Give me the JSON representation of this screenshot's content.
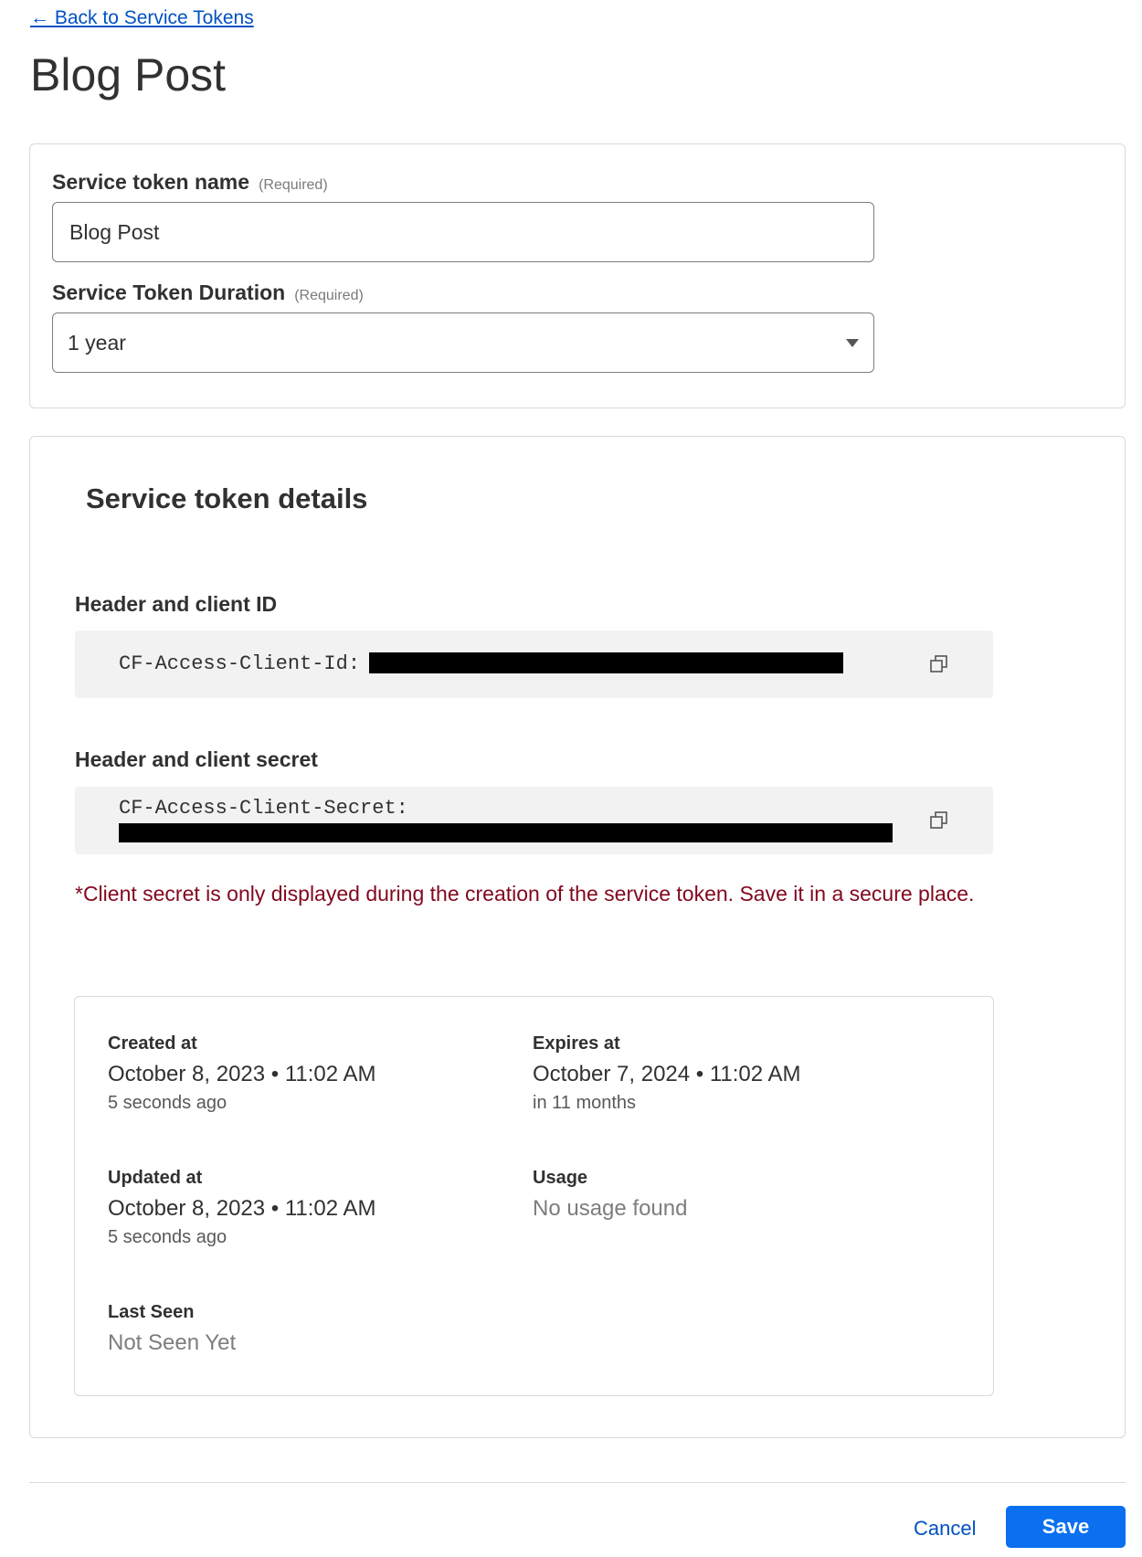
{
  "nav": {
    "back_link": "← Back to Service Tokens"
  },
  "page_title": "Blog Post",
  "form": {
    "name_label": "Service token name",
    "name_required": "(Required)",
    "name_value": "Blog Post",
    "duration_label": "Service Token Duration",
    "duration_required": "(Required)",
    "duration_value": "1 year"
  },
  "details": {
    "title": "Service token details",
    "client_id_label": "Header and client ID",
    "client_id_header": "CF-Access-Client-Id:",
    "client_secret_label": "Header and client secret",
    "client_secret_header": "CF-Access-Client-Secret:",
    "secret_note": "*Client secret is only displayed during the creation of the service token. Save it in a secure place."
  },
  "info": {
    "created": {
      "label": "Created at",
      "value": "October 8, 2023 • 11:02 AM",
      "relative": "5 seconds ago"
    },
    "expires": {
      "label": "Expires at",
      "value": "October 7, 2024 • 11:02 AM",
      "relative": "in 11 months"
    },
    "updated": {
      "label": "Updated at",
      "value": "October 8, 2023 • 11:02 AM",
      "relative": "5 seconds ago"
    },
    "usage": {
      "label": "Usage",
      "value": "No usage found"
    },
    "last_seen": {
      "label": "Last Seen",
      "value": "Not Seen Yet"
    }
  },
  "actions": {
    "cancel": "Cancel",
    "save": "Save"
  },
  "colors": {
    "link": "#0051c3",
    "primary_button": "#0a70ef",
    "warning_text": "#82071e",
    "code_background": "#f2f2f2"
  },
  "icons": {
    "copy_client_id": "copy-icon",
    "copy_client_secret": "copy-icon",
    "duration_caret": "chevron-down-icon"
  }
}
